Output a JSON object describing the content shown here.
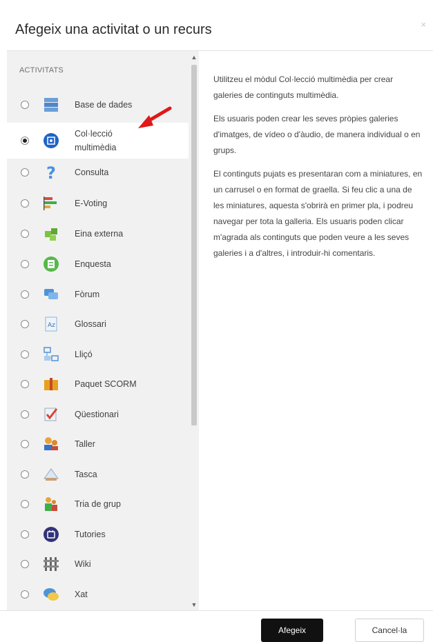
{
  "dialog": {
    "title": "Afegeix una activitat o un recurs",
    "close_glyph": "×"
  },
  "section": {
    "heading": "ACTIVITATS"
  },
  "activities": [
    {
      "label": "Base de dades",
      "icon": "database-icon",
      "selected": false
    },
    {
      "label": "Col·lecció multimèdia",
      "icon": "media-collection-icon",
      "selected": true
    },
    {
      "label": "Consulta",
      "icon": "question-mark-icon",
      "selected": false
    },
    {
      "label": "E-Voting",
      "icon": "bar-chart-icon",
      "selected": false
    },
    {
      "label": "Eina externa",
      "icon": "puzzle-icon",
      "selected": false
    },
    {
      "label": "Enquesta",
      "icon": "survey-icon",
      "selected": false
    },
    {
      "label": "Fòrum",
      "icon": "forum-icon",
      "selected": false
    },
    {
      "label": "Glossari",
      "icon": "glossary-icon",
      "selected": false
    },
    {
      "label": "Lliçó",
      "icon": "lesson-icon",
      "selected": false
    },
    {
      "label": "Paquet SCORM",
      "icon": "package-icon",
      "selected": false
    },
    {
      "label": "Qüestionari",
      "icon": "quiz-icon",
      "selected": false
    },
    {
      "label": "Taller",
      "icon": "workshop-icon",
      "selected": false
    },
    {
      "label": "Tasca",
      "icon": "assignment-icon",
      "selected": false
    },
    {
      "label": "Tria de grup",
      "icon": "group-choice-icon",
      "selected": false
    },
    {
      "label": "Tutories",
      "icon": "tutoring-icon",
      "selected": false
    },
    {
      "label": "Wiki",
      "icon": "wiki-icon",
      "selected": false
    },
    {
      "label": "Xat",
      "icon": "chat-icon",
      "selected": false
    }
  ],
  "description": {
    "p1": "Utilitzeu el mòdul Col·lecció multimèdia per crear galeries de continguts multimèdia.",
    "p2": "Els usuaris poden crear les seves pròpies galeries d'imatges, de vídeo o d'àudio, de manera individual o en grups.",
    "p3": "El continguts pujats es presentaran com a miniatures, en un carrusel o en format de graella. Si feu clic a una de les miniatures, aquesta s'obrirà en primer pla, i podreu navegar per tota la galleria. Els usuaris poden clicar m'agrada als continguts que poden veure a les seves galeries i a d'altres, i introduir-hi comentaris."
  },
  "footer": {
    "add_label": "Afegeix",
    "cancel_label": "Cancel·la"
  },
  "colors": {
    "annotation_arrow": "#e01818",
    "primary_button": "#111111",
    "selected_row": "#ffffff",
    "list_background": "#f1f1f1"
  }
}
